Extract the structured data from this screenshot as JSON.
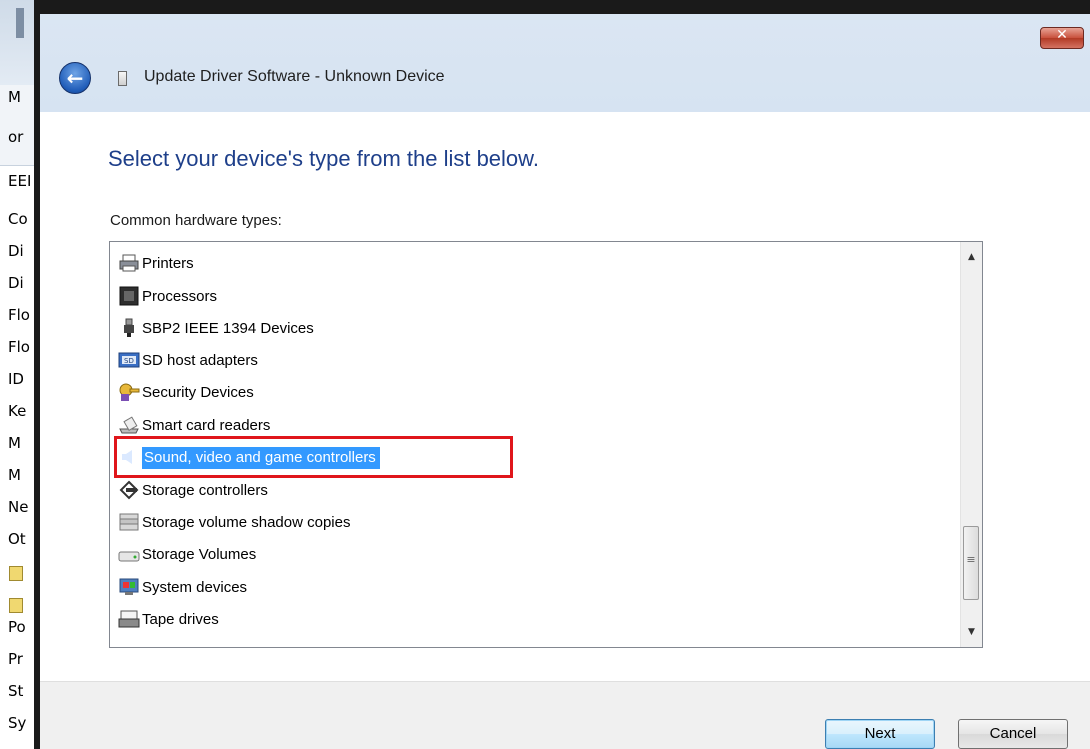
{
  "background_window": {
    "items": [
      "M",
      "or",
      "EEI",
      "Co",
      "Di",
      "Di",
      "Flo",
      "Flo",
      "ID",
      "Ke",
      "M",
      "M",
      "Ne",
      "Ot",
      "",
      "",
      "Po",
      "Pr",
      "St",
      "Sy"
    ]
  },
  "window": {
    "title": "Update Driver Software - Unknown Device",
    "close_label": "✕",
    "back_label": "←"
  },
  "main": {
    "instruction": "Select your device's type from the list below.",
    "list_label": "Common hardware types:"
  },
  "list": {
    "items": [
      {
        "label": "Printers",
        "icon": "printer-icon"
      },
      {
        "label": "Processors",
        "icon": "processor-icon"
      },
      {
        "label": "SBP2 IEEE 1394 Devices",
        "icon": "firewire-plug-icon"
      },
      {
        "label": "SD host adapters",
        "icon": "sd-card-icon"
      },
      {
        "label": "Security Devices",
        "icon": "security-key-icon"
      },
      {
        "label": "Smart card readers",
        "icon": "smart-card-reader-icon"
      },
      {
        "label": "Sound, video and game controllers",
        "icon": "speaker-icon",
        "selected": true
      },
      {
        "label": "Storage controllers",
        "icon": "storage-controller-icon"
      },
      {
        "label": "Storage volume shadow copies",
        "icon": "shadow-copy-icon"
      },
      {
        "label": "Storage Volumes",
        "icon": "drive-icon"
      },
      {
        "label": "System devices",
        "icon": "system-device-icon"
      },
      {
        "label": "Tape drives",
        "icon": "tape-drive-icon"
      }
    ],
    "selected_index": 6
  },
  "buttons": {
    "next": "Next",
    "cancel": "Cancel"
  },
  "colors": {
    "selection": "#3399ff",
    "highlight_box": "#e0161b",
    "instruction_text": "#1e3f8a"
  }
}
